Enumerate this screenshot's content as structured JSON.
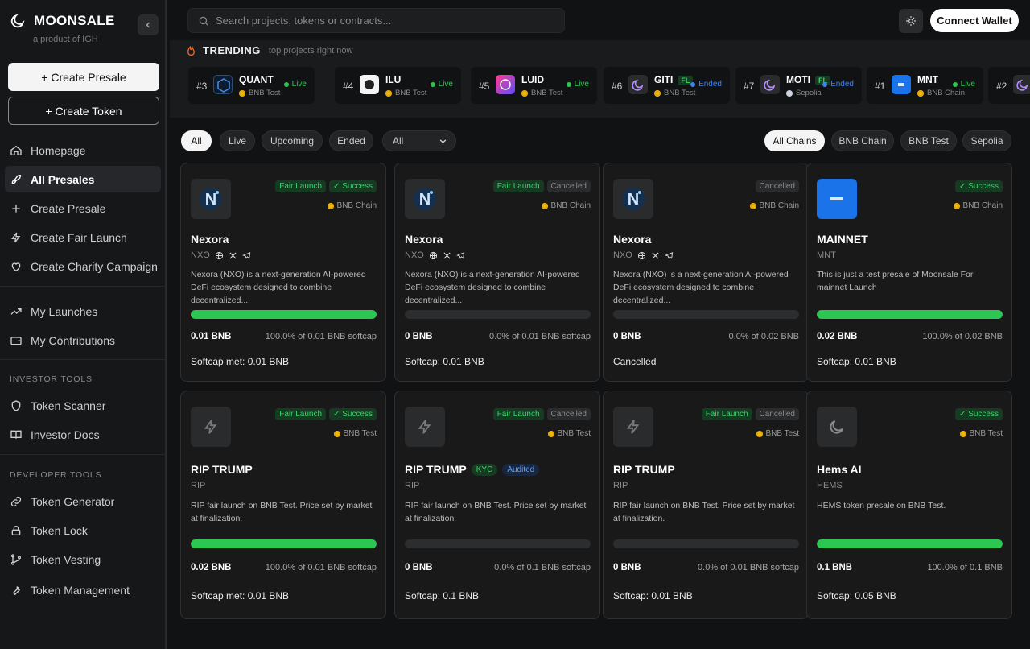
{
  "brand": {
    "name": "MOONSALE",
    "subtitle": "a product of IGH"
  },
  "sidebar": {
    "create_presale": "+ Create Presale",
    "create_token": "+ Create Token",
    "items": [
      {
        "label": "Homepage",
        "icon": "home-icon"
      },
      {
        "label": "All Presales",
        "icon": "rocket-icon",
        "active": true
      },
      {
        "label": "Create Presale",
        "icon": "plus-icon"
      },
      {
        "label": "Create Fair Launch",
        "icon": "lightning-icon"
      },
      {
        "label": "Create Charity Campaign",
        "icon": "heart-icon"
      },
      {
        "label": "My Launches",
        "icon": "trend-icon"
      },
      {
        "label": "My Contributions",
        "icon": "wallet-icon"
      }
    ],
    "investor_section": "INVESTOR TOOLS",
    "investor_items": [
      {
        "label": "Token Scanner",
        "icon": "shield-icon"
      },
      {
        "label": "Investor Docs",
        "icon": "book-icon"
      }
    ],
    "developer_section": "DEVELOPER TOOLS",
    "developer_items": [
      {
        "label": "Token Generator",
        "icon": "link-icon"
      },
      {
        "label": "Token Lock",
        "icon": "lock-icon"
      },
      {
        "label": "Token Vesting",
        "icon": "git-branch-icon"
      },
      {
        "label": "Token Management",
        "icon": "wrench-icon"
      }
    ]
  },
  "topbar": {
    "search_placeholder": "Search projects, tokens or contracts...",
    "connect_wallet": "Connect Wallet"
  },
  "trending": {
    "title": "TRENDING",
    "subtitle": "top projects right now",
    "items": [
      {
        "rank": "#3",
        "name": "QUANT",
        "chain": "BNB Test",
        "status": "Live",
        "status_color": "#2cc753"
      },
      {
        "rank": "#4",
        "name": "ILU",
        "chain": "BNB Test",
        "status": "Live",
        "status_color": "#2cc753"
      },
      {
        "rank": "#5",
        "name": "LUID",
        "chain": "BNB Test",
        "status": "Live",
        "status_color": "#2cc753"
      },
      {
        "rank": "#6",
        "name": "GITI",
        "badge": "FL",
        "chain": "BNB Test",
        "status": "Ended",
        "status_color": "#3b82f6"
      },
      {
        "rank": "#7",
        "name": "MOTI",
        "badge": "FL",
        "chain": "Sepolia",
        "status": "Ended",
        "status_color": "#3b82f6"
      },
      {
        "rank": "#1",
        "name": "MNT",
        "chain": "BNB Chain",
        "status": "Live",
        "status_color": "#2cc753"
      },
      {
        "rank": "#2",
        "name": "",
        "chain": "",
        "status": "",
        "status_color": "#2cc753"
      }
    ]
  },
  "filters": {
    "status": [
      "All",
      "Live",
      "Upcoming",
      "Ended"
    ],
    "type_select": "All",
    "chains": [
      "All Chains",
      "BNB Chain",
      "BNB Test",
      "Sepolia"
    ]
  },
  "cards": [
    {
      "name": "Nexora",
      "symbol": "NXO",
      "badges": [
        "Fair Launch",
        "✓ Success"
      ],
      "chain": "BNB Chain",
      "desc": "Nexora (NXO) is a next-generation AI-powered DeFi ecosystem designed to combine decentralized...",
      "progress": 1.0,
      "raised": "0.01 BNB",
      "of": "100.0% of 0.01 BNB softcap",
      "softcap": "Softcap met: 0.01 BNB"
    },
    {
      "name": "Nexora",
      "symbol": "NXO",
      "badges": [
        "Fair Launch",
        "Cancelled"
      ],
      "chain": "BNB Chain",
      "desc": "Nexora (NXO) is a next-generation AI-powered DeFi ecosystem designed to combine decentralized...",
      "progress": 0.0,
      "raised": "0 BNB",
      "of": "0.0% of 0.01 BNB softcap",
      "softcap": "Softcap: 0.01 BNB"
    },
    {
      "name": "Nexora",
      "symbol": "NXO",
      "badges": [
        "Cancelled"
      ],
      "chain": "BNB Chain",
      "desc": "Nexora (NXO) is a next-generation AI-powered DeFi ecosystem designed to combine decentralized...",
      "progress": 0.0,
      "raised": "0 BNB",
      "of": "0.0% of 0.02 BNB",
      "softcap": "Cancelled"
    },
    {
      "name": "MAINNET",
      "symbol": "MNT",
      "badges": [
        "✓ Success"
      ],
      "chain": "BNB Chain",
      "desc": "This is just a test presale of Moonsale For mainnet Launch",
      "progress": 1.0,
      "raised": "0.02 BNB",
      "of": "100.0% of 0.02 BNB",
      "softcap": "Softcap: 0.01 BNB"
    },
    {
      "name": "RIP TRUMP",
      "symbol": "RIP",
      "badges": [
        "Fair Launch",
        "✓ Success"
      ],
      "chain": "BNB Test",
      "desc": "RIP fair launch on BNB Test. Price set by market at finalization.",
      "progress": 1.0,
      "raised": "0.02 BNB",
      "of": "100.0% of 0.01 BNB softcap",
      "softcap": "Softcap met: 0.01 BNB"
    },
    {
      "name": "RIP TRUMP",
      "symbol": "RIP",
      "kyc": "KYC",
      "audited": "Audited",
      "badges": [
        "Fair Launch",
        "Cancelled"
      ],
      "chain": "BNB Test",
      "desc": "RIP fair launch on BNB Test. Price set by market at finalization.",
      "progress": 0.0,
      "raised": "0 BNB",
      "of": "0.0% of 0.1 BNB softcap",
      "softcap": "Softcap: 0.1 BNB"
    },
    {
      "name": "RIP TRUMP",
      "symbol": "RIP",
      "badges": [
        "Fair Launch",
        "Cancelled"
      ],
      "chain": "BNB Test",
      "desc": "RIP fair launch on BNB Test. Price set by market at finalization.",
      "progress": 0.0,
      "raised": "0 BNB",
      "of": "0.0% of 0.01 BNB softcap",
      "softcap": "Softcap: 0.01 BNB"
    },
    {
      "name": "Hems AI",
      "symbol": "HEMS",
      "badges": [
        "✓ Success"
      ],
      "chain": "BNB Test",
      "desc": "HEMS token presale on BNB Test.",
      "progress": 1.0,
      "raised": "0.1 BNB",
      "of": "100.0% of 0.1 BNB",
      "softcap": "Softcap: 0.05 BNB"
    }
  ]
}
